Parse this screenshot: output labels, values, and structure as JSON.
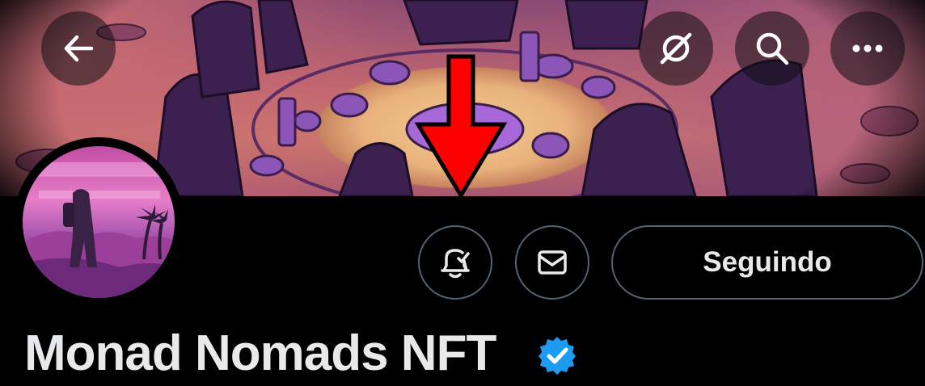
{
  "header": {
    "back_icon": "arrow-left-icon",
    "actions": [
      "eye-slash-icon",
      "search-icon",
      "more-icon"
    ]
  },
  "profile": {
    "display_name": "Monad Nomads NFT",
    "verified": true,
    "verified_color": "#1d9bf0"
  },
  "actions": {
    "notifications_icon": "bell-check-icon",
    "message_icon": "mail-icon",
    "follow_label": "Seguindo"
  },
  "annotation": {
    "type": "arrow",
    "color": "#ff0000"
  }
}
